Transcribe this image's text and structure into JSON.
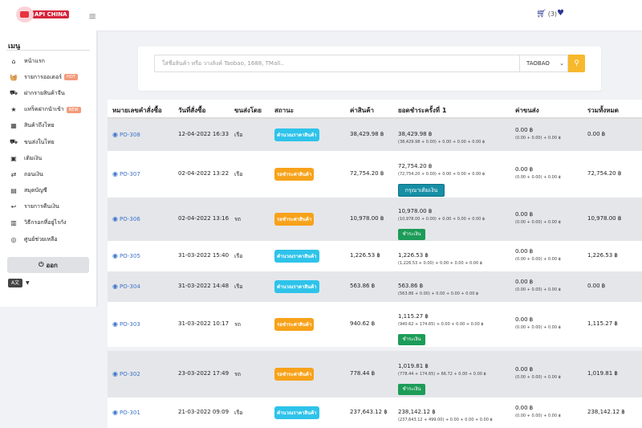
{
  "header": {
    "logo_text": "API CHINA",
    "cart_count": "(3)"
  },
  "sidebar": {
    "title": "เมนู",
    "items": [
      {
        "label": "หน้าแรก",
        "icon": "home-icon",
        "glyph": "⌂",
        "badge": ""
      },
      {
        "label": "รายการออเดอร์",
        "icon": "basket-icon",
        "glyph": "🧺",
        "badge": "HOT"
      },
      {
        "label": "ฝากรายสินค้าจีน",
        "icon": "truck-icon",
        "glyph": "⛟",
        "badge": ""
      },
      {
        "label": "แทร็คฝากนำเข้า",
        "icon": "star-icon",
        "glyph": "★",
        "badge": "NEW"
      },
      {
        "label": "สินค้าถึงไทย",
        "icon": "box-icon",
        "glyph": "▦",
        "badge": ""
      },
      {
        "label": "ขนส่งในไทย",
        "icon": "delivery-truck-icon",
        "glyph": "⛟",
        "badge": ""
      },
      {
        "label": "เติมเงิน",
        "icon": "money-icon",
        "glyph": "▣",
        "badge": ""
      },
      {
        "label": "ถอนเงิน",
        "icon": "exchange-icon",
        "glyph": "⇄",
        "badge": ""
      },
      {
        "label": "สมุดบัญชี",
        "icon": "book-icon",
        "glyph": "▤",
        "badge": ""
      },
      {
        "label": "รายการคืนเงิน",
        "icon": "refund-hand-icon",
        "glyph": "↩",
        "badge": ""
      },
      {
        "label": "วิธีกรอกที่อยู่ไรกัง",
        "icon": "document-icon",
        "glyph": "▥",
        "badge": ""
      },
      {
        "label": "ศูนย์ช่วยเหลือ",
        "icon": "lifebuoy-icon",
        "glyph": "◎",
        "badge": ""
      }
    ],
    "logout_label": "ออก",
    "lang_label": "A文"
  },
  "search": {
    "placeholder": "ใส่ชื่อสินค้า หรือ วางลิงค์ Taobao, 1688, TMall..",
    "select_value": "TAOBAO"
  },
  "table": {
    "headers": [
      "หมายเลขคำสั่งซื้อ",
      "วันที่สั่งซื้อ",
      "ขนส่งโดย",
      "สถานะ",
      "ค่าสินค้า",
      "ยอดชำระครั้งที่ 1",
      "ค่าขนส่ง",
      "รวมทั้งหมด"
    ],
    "rows": [
      {
        "po": "PO-308",
        "date": "12-04-2022 16:33",
        "ship": "เรือ",
        "status": "คำนวณราคาสินค้า",
        "status_color": "#2ec3ea",
        "price": "38,429.98 ฿",
        "paid": "38,429.98 ฿",
        "paid_sub": "(38,429.98 + 0.00) + 0.00 + 0.00 + 0.00 ฿",
        "ship_fee": "0.00 ฿",
        "ship_sub": "(0.00 + 0.00) + 0.00 ฿",
        "total": "0.00 ฿",
        "button": ""
      },
      {
        "po": "PO-307",
        "date": "02-04-2022 13:22",
        "ship": "เรือ",
        "status": "รอชำระค่าสินค้า",
        "status_color": "#f7a21a",
        "price": "72,754.20 ฿",
        "paid": "72,754.20 ฿",
        "paid_sub": "(72,754.20 + 0.00) + 0.00 + 0.00 + 0.00 ฿",
        "ship_fee": "0.00 ฿",
        "ship_sub": "(0.00 + 0.00) + 0.00 ฿",
        "total": "72,754.20 ฿",
        "button": "กรุณาเติมเงิน"
      },
      {
        "po": "PO-306",
        "date": "02-04-2022 13:16",
        "ship": "รถ",
        "status": "รอชำระค่าสินค้า",
        "status_color": "#f7a21a",
        "price": "10,978.00 ฿",
        "paid": "10,978.00 ฿",
        "paid_sub": "(10,978.00 + 0.00) + 0.00 + 0.00 + 0.00 ฿",
        "ship_fee": "0.00 ฿",
        "ship_sub": "(0.00 + 0.00) + 0.00 ฿",
        "total": "10,978.00 ฿",
        "button": "ชำระเงิน"
      },
      {
        "po": "PO-305",
        "date": "31-03-2022 15:40",
        "ship": "เรือ",
        "status": "คำนวณราคาสินค้า",
        "status_color": "#2ec3ea",
        "price": "1,226.53 ฿",
        "paid": "1,226.53 ฿",
        "paid_sub": "(1,226.53 + 0.00) + 0.00 + 0.00 + 0.00 ฿",
        "ship_fee": "0.00 ฿",
        "ship_sub": "(0.00 + 0.00) + 0.00 ฿",
        "total": "1,226.53 ฿",
        "button": ""
      },
      {
        "po": "PO-304",
        "date": "31-03-2022 14:48",
        "ship": "เรือ",
        "status": "คำนวณราคาสินค้า",
        "status_color": "#2ec3ea",
        "price": "563.86 ฿",
        "paid": "563.86 ฿",
        "paid_sub": "(563.86 + 0.00) + 0.00 + 0.00 + 0.00 ฿",
        "ship_fee": "0.00 ฿",
        "ship_sub": "(0.00 + 0.00) + 0.00 ฿",
        "total": "0.00 ฿",
        "button": ""
      },
      {
        "po": "PO-303",
        "date": "31-03-2022 10:17",
        "ship": "รถ",
        "status": "รอชำระค่าสินค้า",
        "status_color": "#f7a21a",
        "price": "940.62 ฿",
        "paid": "1,115.27 ฿",
        "paid_sub": "(940.62 + 174.65) + 0.00 + 0.00 + 0.00 ฿",
        "ship_fee": "0.00 ฿",
        "ship_sub": "(0.00 + 0.00) + 0.00 ฿",
        "total": "1,115.27 ฿",
        "button": "ชำระเงิน"
      },
      {
        "po": "PO-302",
        "date": "23-03-2022 17:49",
        "ship": "รถ",
        "status": "รอชำระค่าสินค้า",
        "status_color": "#f7a21a",
        "price": "778.44 ฿",
        "paid": "1,019.81 ฿",
        "paid_sub": "(778.44 + 174.65) + 66.72 + 0.00 + 0.00 ฿",
        "ship_fee": "0.00 ฿",
        "ship_sub": "(0.00 + 0.00) + 0.00 ฿",
        "total": "1,019.81 ฿",
        "button": "ชำระเงิน"
      },
      {
        "po": "PO-301",
        "date": "21-03-2022 09:09",
        "ship": "เรือ",
        "status": "คำนวณราคาสินค้า",
        "status_color": "#2ec3ea",
        "price": "237,643.12 ฿",
        "paid": "238,142.12 ฿",
        "paid_sub": "(237,643.12 + 499.00) + 0.00 + 0.00 + 0.00 ฿",
        "ship_fee": "0.00 ฿",
        "ship_sub": "(0.00 + 0.00) + 0.00 ฿",
        "total": "238,142.12 ฿",
        "button": ""
      }
    ]
  }
}
